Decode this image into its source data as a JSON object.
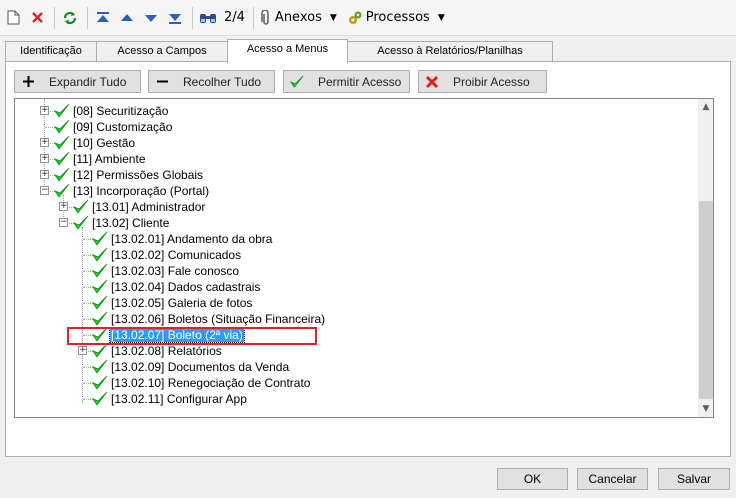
{
  "toolbar": {
    "page_indicator": "2/4",
    "anexos_label": "Anexos",
    "processos_label": "Processos"
  },
  "tabs": [
    {
      "label": "Identificação"
    },
    {
      "label": "Acesso a Campos"
    },
    {
      "label": "Acesso a Menus"
    },
    {
      "label": "Acesso à Relatórios/Planilhas"
    }
  ],
  "actions": {
    "expand_all": "Expandir Tudo",
    "collapse_all": "Recolher Tudo",
    "allow_access": "Permitir Acesso",
    "deny_access": "Proibir Acesso"
  },
  "tree": {
    "nodes": [
      {
        "label": "[08] Securitização"
      },
      {
        "label": "[09] Customização"
      },
      {
        "label": "[10] Gestão"
      },
      {
        "label": "[11] Ambiente"
      },
      {
        "label": "[12] Permissões Globais"
      },
      {
        "label": "[13] Incorporação (Portal)"
      },
      {
        "label": "[13.01] Administrador"
      },
      {
        "label": "[13.02] Cliente"
      },
      {
        "label": "[13.02.01] Andamento da obra"
      },
      {
        "label": "[13.02.02] Comunicados"
      },
      {
        "label": "[13.02.03] Fale conosco"
      },
      {
        "label": "[13.02.04] Dados cadastrais"
      },
      {
        "label": "[13.02.05] Galeria de fotos"
      },
      {
        "label": "[13.02.06] Boletos (Situação Financeira)"
      },
      {
        "label": "[13.02.07] Boleto (2ª via)"
      },
      {
        "label": "[13.02.08] Relatórios"
      },
      {
        "label": "[13.02.09] Documentos da Venda"
      },
      {
        "label": "[13.02.10] Renegociação de Contrato"
      },
      {
        "label": "[13.02.11] Configurar App"
      }
    ]
  },
  "footer": {
    "ok": "OK",
    "cancel": "Cancelar",
    "save": "Salvar"
  }
}
